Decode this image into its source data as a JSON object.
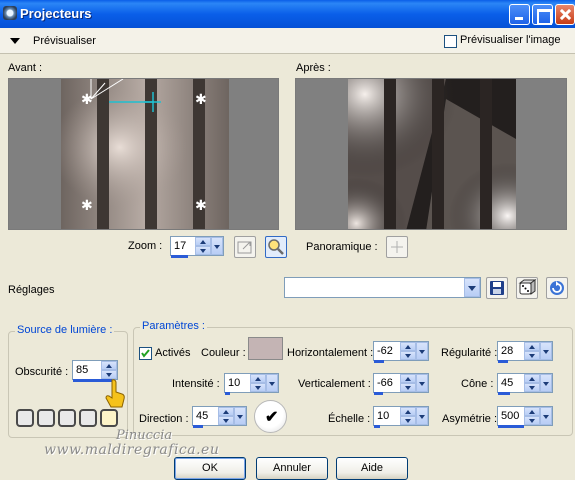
{
  "window": {
    "title": "Projecteurs"
  },
  "preview_bar": {
    "label": "Prévisualiser",
    "image_checkbox_label": "Prévisualiser l'image",
    "image_checked": false
  },
  "panels": {
    "before_label": "Avant :",
    "after_label": "Après :"
  },
  "zoom": {
    "label": "Zoom :",
    "value": "17"
  },
  "pan": {
    "label": "Panoramique :"
  },
  "presets": {
    "label": "Réglages",
    "value": ""
  },
  "light_source": {
    "legend": "Source de lumière :",
    "darkness_label": "Obscurité :",
    "darkness_value": "85"
  },
  "params": {
    "legend": "Paramètres :",
    "enabled_label": "Activés",
    "enabled_checked": true,
    "color_label": "Couleur :",
    "color_value": "#c4b4b4",
    "intensity_label": "Intensité :",
    "intensity_value": "10",
    "direction_label": "Direction :",
    "direction_value": "45",
    "horizontal_label": "Horizontalement :",
    "horizontal_value": "-62",
    "vertical_label": "Verticalement :",
    "vertical_value": "-66",
    "scale_label": "Échelle :",
    "scale_value": "10",
    "regularity_label": "Régularité :",
    "regularity_value": "28",
    "cone_label": "Cône :",
    "cone_value": "45",
    "asymmetry_label": "Asymétrie :",
    "asymmetry_value": "500"
  },
  "buttons": {
    "ok": "OK",
    "cancel": "Annuler",
    "help": "Aide"
  },
  "watermark": {
    "line1": "Pinuccia",
    "line2": "www.maldiregrafica.eu"
  }
}
